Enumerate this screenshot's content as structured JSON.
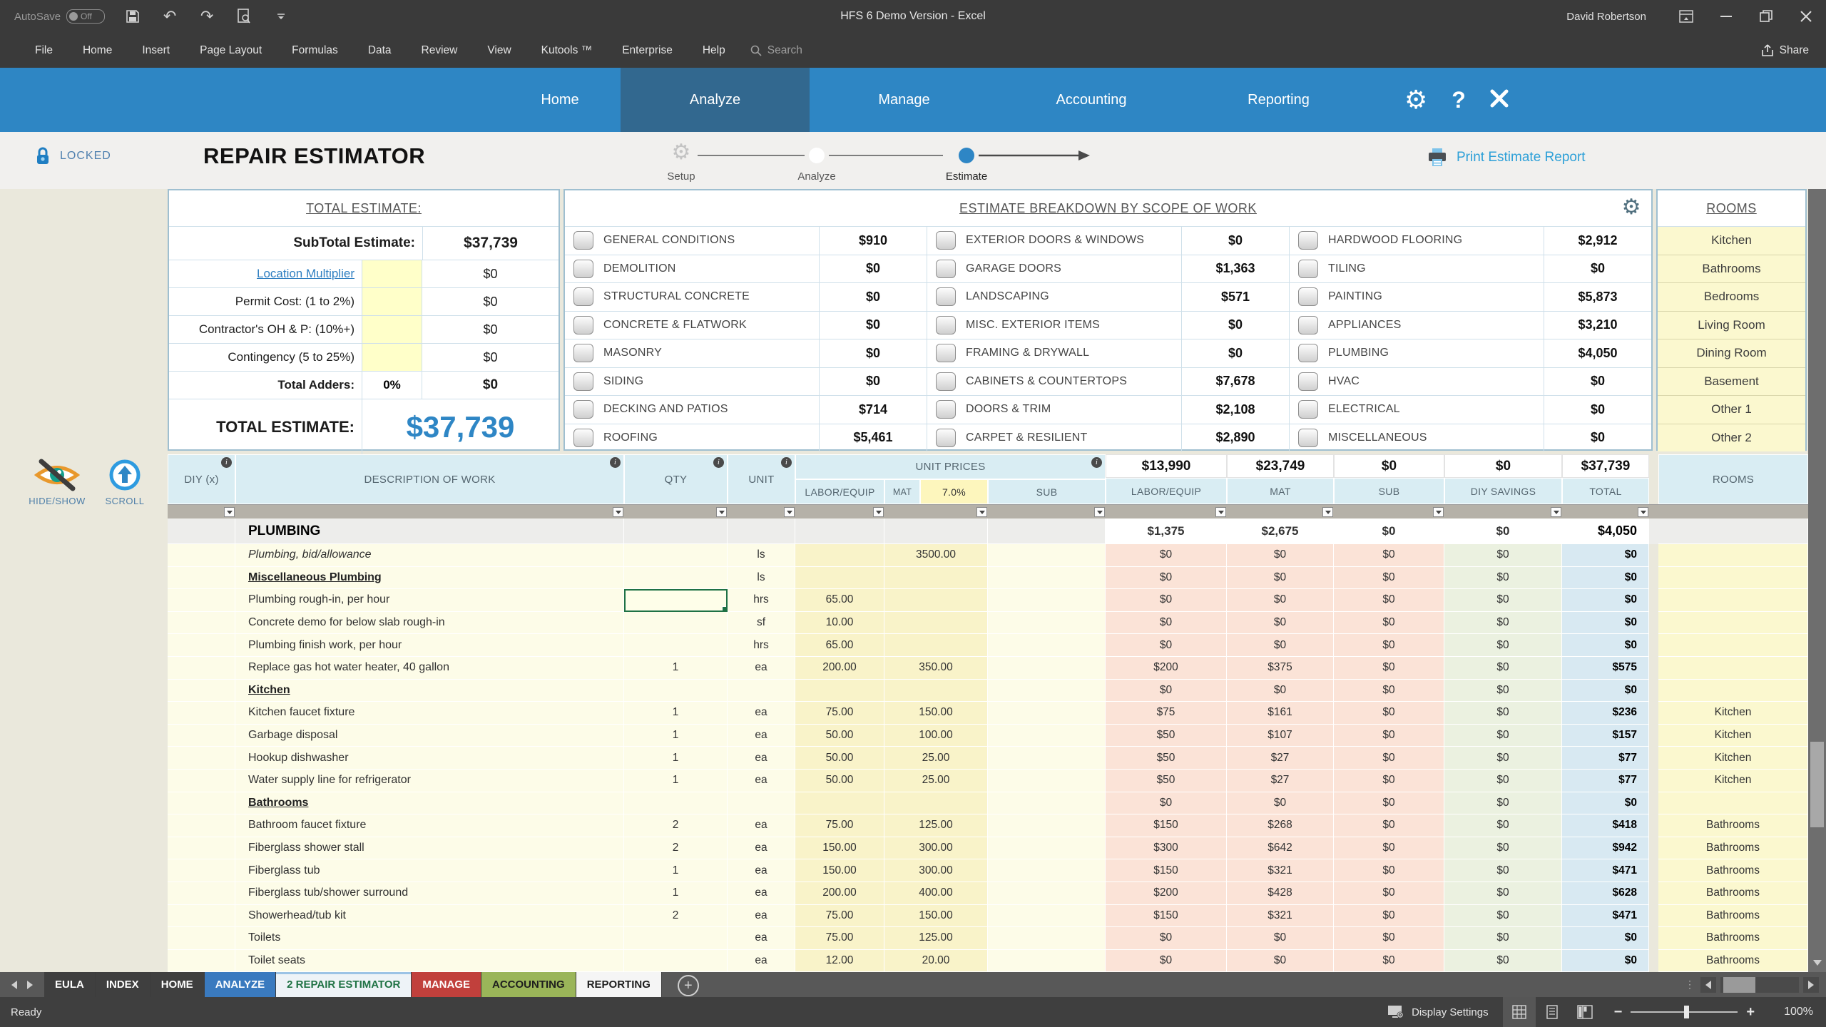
{
  "titlebar": {
    "autosave_label": "AutoSave",
    "autosave_state": "Off",
    "title": "HFS 6 Demo Version - Excel",
    "user": "David Robertson"
  },
  "menubar": {
    "items": [
      "File",
      "Home",
      "Insert",
      "Page Layout",
      "Formulas",
      "Data",
      "Review",
      "View",
      "Kutools ™",
      "Enterprise",
      "Help"
    ],
    "search_placeholder": "Search",
    "share_label": "Share"
  },
  "nav": {
    "items": [
      "Home",
      "Analyze",
      "Manage",
      "Accounting",
      "Reporting"
    ],
    "active": "Analyze"
  },
  "app_header": {
    "locked_label": "LOCKED",
    "title": "REPAIR ESTIMATOR",
    "steps": [
      {
        "label": "Setup",
        "state": "gear"
      },
      {
        "label": "Analyze",
        "state": "circle"
      },
      {
        "label": "Estimate",
        "state": "dot"
      }
    ],
    "print_label": "Print Estimate Report"
  },
  "summary": {
    "title": "TOTAL ESTIMATE:",
    "subtotal_label": "SubTotal Estimate:",
    "subtotal_value": "$37,739",
    "input_rows": [
      {
        "label": "Location Multiplier",
        "value": "$0",
        "link": true
      },
      {
        "label": "Permit Cost: (1 to 2%)",
        "value": "$0",
        "link": false
      },
      {
        "label": "Contractor's OH & P: (10%+)",
        "value": "$0",
        "link": false
      },
      {
        "label": "Contingency (5 to 25%)",
        "value": "$0",
        "link": false
      }
    ],
    "adders_label": "Total Adders:",
    "adders_pct": "0%",
    "adders_value": "$0",
    "grand_label": "TOTAL ESTIMATE:",
    "grand_value": "$37,739"
  },
  "breakdown": {
    "title": "ESTIMATE BREAKDOWN BY SCOPE OF WORK",
    "groups": [
      [
        {
          "label": "GENERAL CONDITIONS",
          "value": "$910"
        },
        {
          "label": "DEMOLITION",
          "value": "$0"
        },
        {
          "label": "STRUCTURAL CONCRETE",
          "value": "$0"
        },
        {
          "label": "CONCRETE & FLATWORK",
          "value": "$0"
        },
        {
          "label": "MASONRY",
          "value": "$0"
        },
        {
          "label": "SIDING",
          "value": "$0"
        },
        {
          "label": "DECKING AND PATIOS",
          "value": "$714"
        },
        {
          "label": "ROOFING",
          "value": "$5,461"
        }
      ],
      [
        {
          "label": "EXTERIOR DOORS & WINDOWS",
          "value": "$0"
        },
        {
          "label": "GARAGE DOORS",
          "value": "$1,363"
        },
        {
          "label": "LANDSCAPING",
          "value": "$571"
        },
        {
          "label": "MISC. EXTERIOR ITEMS",
          "value": "$0"
        },
        {
          "label": "FRAMING & DRYWALL",
          "value": "$0"
        },
        {
          "label": "CABINETS & COUNTERTOPS",
          "value": "$7,678"
        },
        {
          "label": "DOORS & TRIM",
          "value": "$2,108"
        },
        {
          "label": "CARPET & RESILIENT",
          "value": "$2,890"
        }
      ],
      [
        {
          "label": "HARDWOOD FLOORING",
          "value": "$2,912"
        },
        {
          "label": "TILING",
          "value": "$0"
        },
        {
          "label": "PAINTING",
          "value": "$5,873"
        },
        {
          "label": "APPLIANCES",
          "value": "$3,210"
        },
        {
          "label": "PLUMBING",
          "value": "$4,050"
        },
        {
          "label": "HVAC",
          "value": "$0"
        },
        {
          "label": "ELECTRICAL",
          "value": "$0"
        },
        {
          "label": "MISCELLANEOUS",
          "value": "$0"
        }
      ]
    ]
  },
  "rooms_panel": {
    "title": "ROOMS",
    "items": [
      "Kitchen",
      "Bathrooms",
      "Bedrooms",
      "Living Room",
      "Dining Room",
      "Basement",
      "Other 1",
      "Other 2"
    ]
  },
  "tools": {
    "hide_show": "HIDE/SHOW",
    "scroll": "SCROLL"
  },
  "grid": {
    "headers": {
      "diy": "DIY (x)",
      "desc": "DESCRIPTION OF WORK",
      "qty": "QTY",
      "unit": "UNIT",
      "unit_prices": "UNIT PRICES",
      "labor": "LABOR/EQUIP",
      "mat": "MAT",
      "mat_rate": "7.0%",
      "sub": "SUB",
      "diy_savings": "DIY SAVINGS",
      "total": "TOTAL",
      "rooms": "ROOMS"
    },
    "totals": {
      "labor": "$13,990",
      "mat": "$23,749",
      "sub": "$0",
      "diy_savings": "$0",
      "total": "$37,739"
    },
    "rows": [
      {
        "t": "sec",
        "desc": "PLUMBING",
        "m": [
          "$1,375",
          "$2,675",
          "$0",
          "$0",
          "$4,050"
        ],
        "room": ""
      },
      {
        "t": "item",
        "style": "italic",
        "desc": "Plumbing, bid/allowance",
        "qty": "",
        "unit": "ls",
        "up": [
          "",
          "3500.00",
          ""
        ],
        "m": [
          "$0",
          "$0",
          "$0",
          "$0",
          "$0"
        ],
        "room": ""
      },
      {
        "t": "item",
        "style": "sub",
        "desc": "Miscellaneous Plumbing",
        "qty": "",
        "unit": "ls",
        "up": [
          "",
          "",
          ""
        ],
        "m": [
          "$0",
          "$0",
          "$0",
          "$0",
          "$0"
        ],
        "room": ""
      },
      {
        "t": "item",
        "desc": "Plumbing rough-in, per hour",
        "qty": "",
        "unit": "hrs",
        "up": [
          "65.00",
          "",
          ""
        ],
        "m": [
          "$0",
          "$0",
          "$0",
          "$0",
          "$0"
        ],
        "room": "",
        "selected": true
      },
      {
        "t": "item",
        "desc": "Concrete demo for below slab rough-in",
        "qty": "",
        "unit": "sf",
        "up": [
          "10.00",
          "",
          ""
        ],
        "m": [
          "$0",
          "$0",
          "$0",
          "$0",
          "$0"
        ],
        "room": ""
      },
      {
        "t": "item",
        "desc": "Plumbing finish work, per hour",
        "qty": "",
        "unit": "hrs",
        "up": [
          "65.00",
          "",
          ""
        ],
        "m": [
          "$0",
          "$0",
          "$0",
          "$0",
          "$0"
        ],
        "room": ""
      },
      {
        "t": "item",
        "desc": "Replace gas hot water heater, 40 gallon",
        "qty": "1",
        "unit": "ea",
        "up": [
          "200.00",
          "350.00",
          ""
        ],
        "m": [
          "$200",
          "$375",
          "$0",
          "$0",
          "$575"
        ],
        "room": ""
      },
      {
        "t": "item",
        "style": "sub",
        "desc": "Kitchen",
        "qty": "",
        "unit": "",
        "up": [
          "",
          "",
          ""
        ],
        "m": [
          "$0",
          "$0",
          "$0",
          "$0",
          "$0"
        ],
        "room": ""
      },
      {
        "t": "item",
        "desc": "Kitchen faucet fixture",
        "qty": "1",
        "unit": "ea",
        "up": [
          "75.00",
          "150.00",
          ""
        ],
        "m": [
          "$75",
          "$161",
          "$0",
          "$0",
          "$236"
        ],
        "room": "Kitchen"
      },
      {
        "t": "item",
        "desc": "Garbage disposal",
        "qty": "1",
        "unit": "ea",
        "up": [
          "50.00",
          "100.00",
          ""
        ],
        "m": [
          "$50",
          "$107",
          "$0",
          "$0",
          "$157"
        ],
        "room": "Kitchen"
      },
      {
        "t": "item",
        "desc": "Hookup dishwasher",
        "qty": "1",
        "unit": "ea",
        "up": [
          "50.00",
          "25.00",
          ""
        ],
        "m": [
          "$50",
          "$27",
          "$0",
          "$0",
          "$77"
        ],
        "room": "Kitchen"
      },
      {
        "t": "item",
        "desc": "Water supply line for refrigerator",
        "qty": "1",
        "unit": "ea",
        "up": [
          "50.00",
          "25.00",
          ""
        ],
        "m": [
          "$50",
          "$27",
          "$0",
          "$0",
          "$77"
        ],
        "room": "Kitchen"
      },
      {
        "t": "item",
        "style": "sub",
        "desc": "Bathrooms",
        "qty": "",
        "unit": "",
        "up": [
          "",
          "",
          ""
        ],
        "m": [
          "$0",
          "$0",
          "$0",
          "$0",
          "$0"
        ],
        "room": ""
      },
      {
        "t": "item",
        "desc": "Bathroom faucet fixture",
        "qty": "2",
        "unit": "ea",
        "up": [
          "75.00",
          "125.00",
          ""
        ],
        "m": [
          "$150",
          "$268",
          "$0",
          "$0",
          "$418"
        ],
        "room": "Bathrooms"
      },
      {
        "t": "item",
        "desc": "Fiberglass shower stall",
        "qty": "2",
        "unit": "ea",
        "up": [
          "150.00",
          "300.00",
          ""
        ],
        "m": [
          "$300",
          "$642",
          "$0",
          "$0",
          "$942"
        ],
        "room": "Bathrooms"
      },
      {
        "t": "item",
        "desc": "Fiberglass tub",
        "qty": "1",
        "unit": "ea",
        "up": [
          "150.00",
          "300.00",
          ""
        ],
        "m": [
          "$150",
          "$321",
          "$0",
          "$0",
          "$471"
        ],
        "room": "Bathrooms"
      },
      {
        "t": "item",
        "desc": "Fiberglass tub/shower surround",
        "qty": "1",
        "unit": "ea",
        "up": [
          "200.00",
          "400.00",
          ""
        ],
        "m": [
          "$200",
          "$428",
          "$0",
          "$0",
          "$628"
        ],
        "room": "Bathrooms"
      },
      {
        "t": "item",
        "desc": "Showerhead/tub kit",
        "qty": "2",
        "unit": "ea",
        "up": [
          "75.00",
          "150.00",
          ""
        ],
        "m": [
          "$150",
          "$321",
          "$0",
          "$0",
          "$471"
        ],
        "room": "Bathrooms"
      },
      {
        "t": "item",
        "desc": "Toilets",
        "qty": "",
        "unit": "ea",
        "up": [
          "75.00",
          "125.00",
          ""
        ],
        "m": [
          "$0",
          "$0",
          "$0",
          "$0",
          "$0"
        ],
        "room": "Bathrooms"
      },
      {
        "t": "item",
        "desc": "Toilet seats",
        "qty": "",
        "unit": "ea",
        "up": [
          "12.00",
          "20.00",
          ""
        ],
        "m": [
          "$0",
          "$0",
          "$0",
          "$0",
          "$0"
        ],
        "room": "Bathrooms"
      }
    ]
  },
  "sheet_tabs": [
    {
      "label": "EULA",
      "bg": "#3f3f3f",
      "fg": "#ffffff",
      "active": false
    },
    {
      "label": "INDEX",
      "bg": "#3f3f3f",
      "fg": "#ffffff",
      "active": false
    },
    {
      "label": "HOME",
      "bg": "#3f3f3f",
      "fg": "#ffffff",
      "active": false
    },
    {
      "label": "ANALYZE",
      "bg": "#3a7abf",
      "fg": "#ffffff",
      "active": false
    },
    {
      "label": "2 REPAIR ESTIMATOR",
      "bg": "#eef3f7",
      "fg": "#1f7244",
      "active": true
    },
    {
      "label": "MANAGE",
      "bg": "#c1403c",
      "fg": "#ffffff",
      "active": false
    },
    {
      "label": "ACCOUNTING",
      "bg": "#9ab559",
      "fg": "#1d1d1d",
      "active": false
    },
    {
      "label": "REPORTING",
      "bg": "#f5f5f5",
      "fg": "#1d1d1d",
      "active": false
    }
  ],
  "statusbar": {
    "ready": "Ready",
    "display_settings": "Display Settings",
    "zoom_level": "100%"
  }
}
